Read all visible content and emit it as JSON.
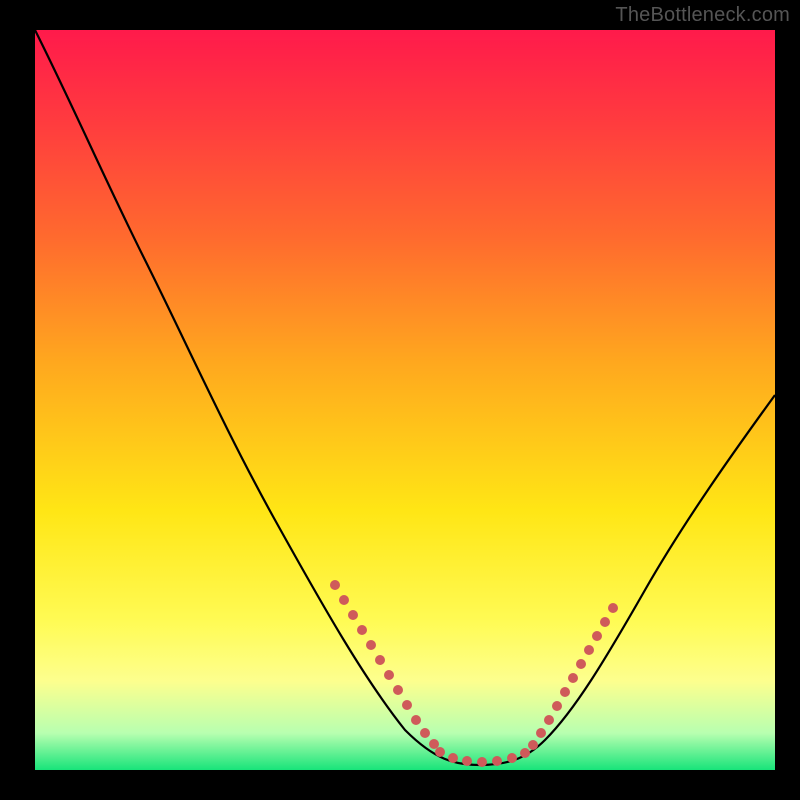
{
  "watermark": "TheBottleneck.com",
  "chart_data": {
    "type": "line",
    "title": "",
    "xlabel": "",
    "ylabel": "",
    "xlim": [
      0,
      100
    ],
    "ylim": [
      0,
      100
    ],
    "grid": false,
    "legend": false,
    "note": "Axes have no visible tick labels; values below are estimated positions in 0–100 plot-area coordinates (0,0 = bottom-left).",
    "series": [
      {
        "name": "curve",
        "x": [
          0,
          3,
          7,
          12,
          18,
          24,
          30,
          36,
          42,
          47,
          51,
          55,
          59,
          62,
          65,
          68,
          72,
          76,
          80,
          85,
          90,
          95,
          100
        ],
        "y": [
          100,
          94,
          86,
          76,
          65,
          54,
          43,
          32,
          22,
          14,
          8,
          4,
          2,
          1.5,
          1.5,
          2,
          5,
          10,
          17,
          26,
          36,
          45,
          53
        ]
      },
      {
        "name": "highlight-left",
        "style": "dotted",
        "color": "#d66",
        "x": [
          40,
          42,
          44,
          46,
          48,
          50,
          52
        ],
        "y": [
          25,
          21,
          17,
          13,
          9,
          6,
          4
        ]
      },
      {
        "name": "highlight-bottom",
        "style": "dotted",
        "color": "#d66",
        "x": [
          52,
          55,
          58,
          60,
          62,
          64,
          66,
          68
        ],
        "y": [
          3,
          2,
          1.5,
          1.5,
          1.5,
          1.8,
          2.5,
          3.5
        ]
      },
      {
        "name": "highlight-right",
        "style": "dotted",
        "color": "#d66",
        "x": [
          68,
          70,
          72,
          74,
          76
        ],
        "y": [
          4,
          7,
          11,
          16,
          21
        ]
      }
    ]
  }
}
